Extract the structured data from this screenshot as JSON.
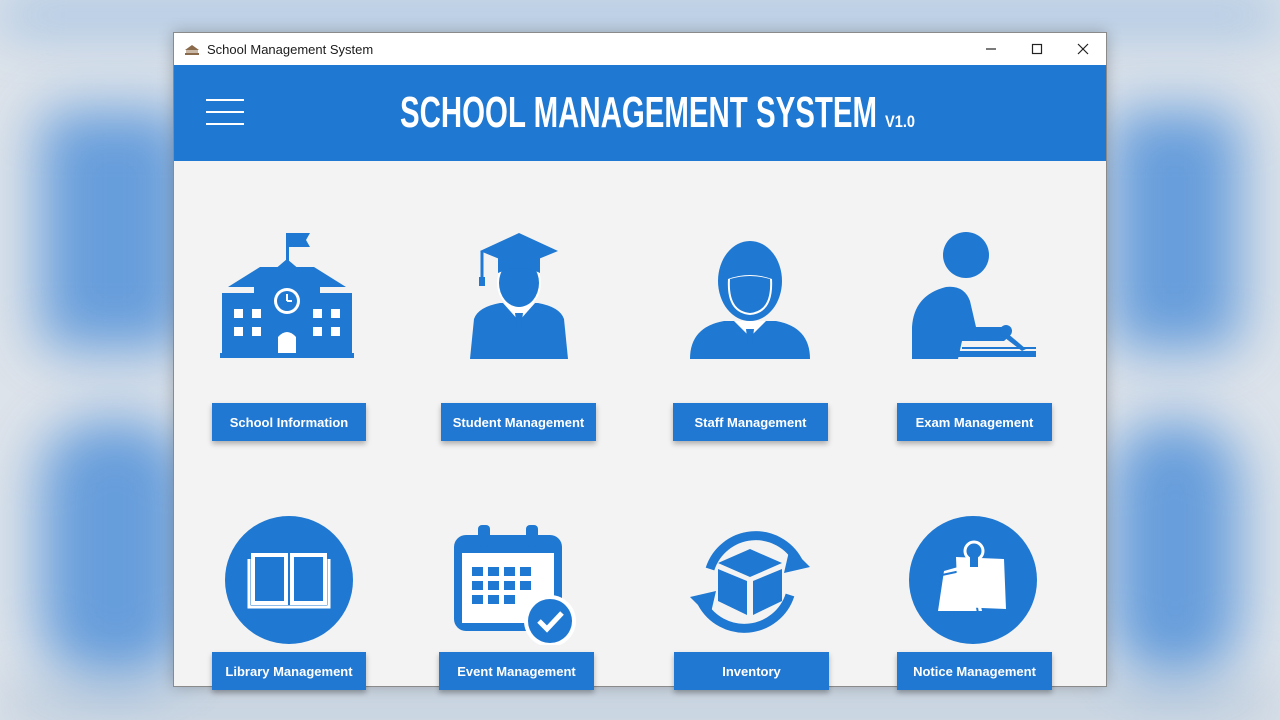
{
  "window": {
    "title": "School Management System",
    "controls": {
      "minimize": "minimize",
      "maximize": "maximize",
      "close": "close"
    }
  },
  "header": {
    "title": "SCHOOL MANAGEMENT SYSTEM",
    "version": "V1.0",
    "menu_icon": "hamburger-icon"
  },
  "colors": {
    "primary": "#1f78d1",
    "button": "#2178d2",
    "background": "#f3f3f3"
  },
  "modules": [
    {
      "label": "School Information",
      "icon": "school-building-icon"
    },
    {
      "label": "Student Management",
      "icon": "graduate-icon"
    },
    {
      "label": "Staff Management",
      "icon": "staff-person-icon"
    },
    {
      "label": "Exam Management",
      "icon": "exam-writing-icon"
    },
    {
      "label": "Library Management",
      "icon": "open-book-icon"
    },
    {
      "label": "Event Management",
      "icon": "calendar-check-icon"
    },
    {
      "label": "Inventory",
      "icon": "box-cycle-icon"
    },
    {
      "label": "Notice Management",
      "icon": "pinned-note-icon"
    }
  ]
}
